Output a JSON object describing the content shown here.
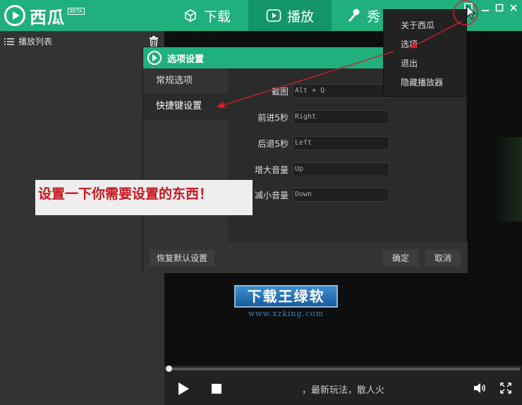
{
  "app": {
    "name": "西瓜",
    "badge": "BETA"
  },
  "nav": {
    "tabs": [
      {
        "label": "下载",
        "icon": "box-icon"
      },
      {
        "label": "播放",
        "icon": "play-icon"
      },
      {
        "label": "秀",
        "icon": "microphone-icon"
      }
    ],
    "active_tab": "播放"
  },
  "playlist": {
    "title": "播放列表"
  },
  "menu": {
    "items": [
      "关于西瓜",
      "选项",
      "退出",
      "隐藏播放器"
    ]
  },
  "dialog": {
    "title": "选项设置",
    "sidebar": [
      "常规选项",
      "快捷键设置"
    ],
    "active_section": "快捷键设置",
    "hotkeys": [
      {
        "label": "截图",
        "value": "Alt + Q"
      },
      {
        "label": "前进5秒",
        "value": "Right"
      },
      {
        "label": "后退5秒",
        "value": "Left"
      },
      {
        "label": "增大音量",
        "value": "Up"
      },
      {
        "label": "减小音量",
        "value": "Down"
      }
    ],
    "reset_label": "恢复默认设置",
    "ok_label": "确定",
    "cancel_label": "取消"
  },
  "annotation": {
    "text": "设置一下你需要设置的东西！"
  },
  "watermark": {
    "title": "下载王绿软",
    "url": "www.xzking.com"
  },
  "player": {
    "marquee": "，最新玩法，散人火",
    "progress": 0.0
  },
  "colors": {
    "brand": "#1fb07e",
    "annotation_red": "#c8141e"
  }
}
